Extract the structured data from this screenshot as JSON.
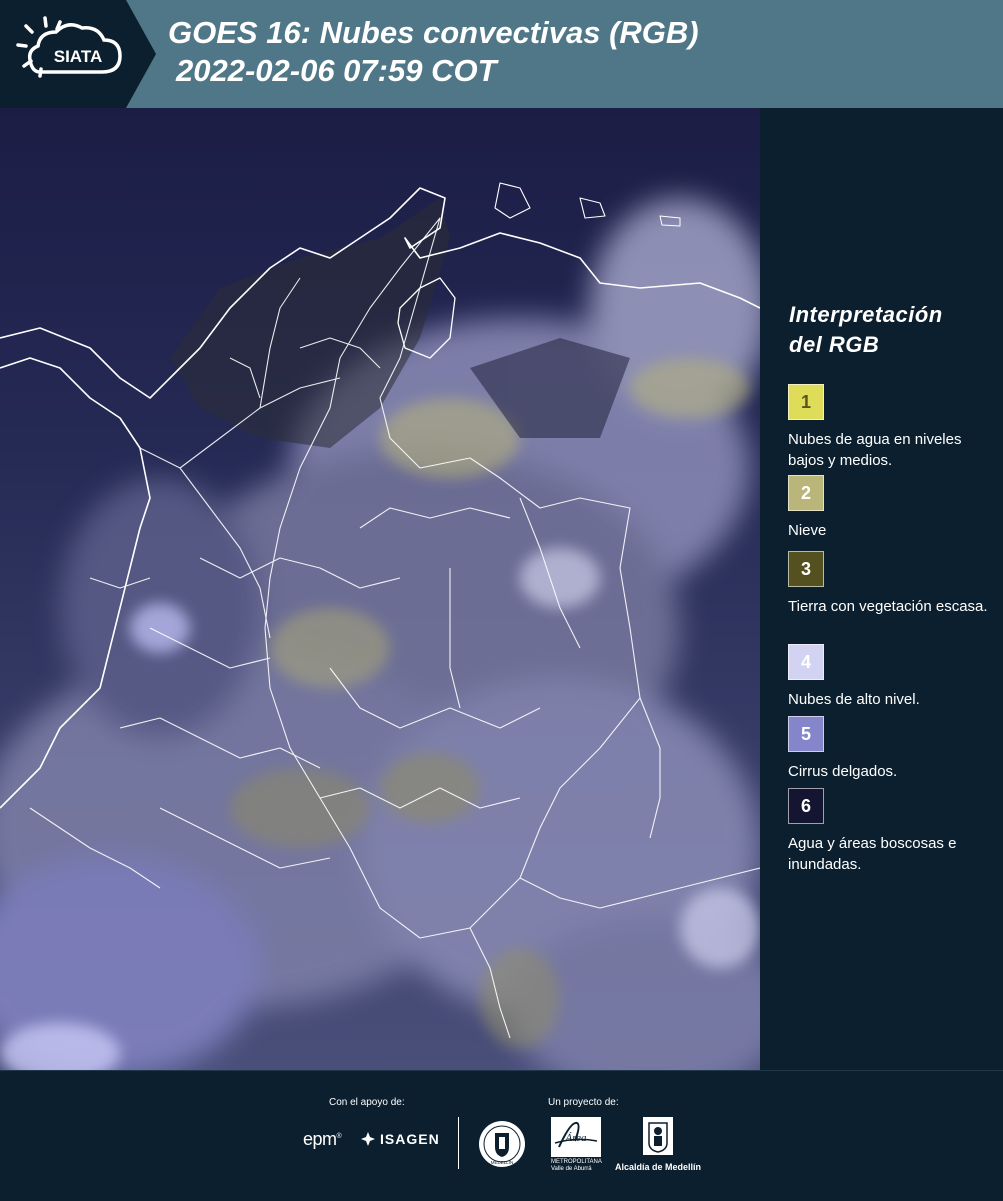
{
  "header": {
    "logo_text": "SIATA",
    "title_line1": "GOES 16: Nubes convectivas (RGB)",
    "title_line2": "2022-02-06 07:59 COT",
    "bg_color": "#4f7787"
  },
  "legend": {
    "title_line1": "Interpretación",
    "title_line2": "del RGB",
    "items": [
      {
        "number": "1",
        "label": "Nubes de agua en niveles bajos y medios.",
        "color": "#dfdc5a",
        "text_color": "#5a5520"
      },
      {
        "number": "2",
        "label": "Nieve",
        "color": "#bab679",
        "text_color": "#ffffff"
      },
      {
        "number": "3",
        "label": "Tierra con vegetación escasa.",
        "color": "#545020",
        "text_color": "#ffffff"
      },
      {
        "number": "4",
        "label": "Nubes de alto nivel.",
        "color": "#d2d2f3",
        "text_color": "#ffffff"
      },
      {
        "number": "5",
        "label": "Cirrus delgados.",
        "color": "#8585cc",
        "text_color": "#ffffff"
      },
      {
        "number": "6",
        "label": "Agua y áreas boscosas e inundadas.",
        "color": "#141530",
        "text_color": "#ffffff"
      }
    ]
  },
  "footer": {
    "support_label": "Con el apoyo de:",
    "project_label": "Un proyecto de:",
    "sponsor1": "epm",
    "sponsor2": "ISAGEN",
    "partner_area": "Área",
    "partner_area_sub": "METROPOLITANA Valle de Aburrá",
    "partner_alcaldia": "Alcaldía de Medellín",
    "seal_text": "MEDELLÍN"
  },
  "map": {
    "background_color": "#1a1d48",
    "border_color": "#ffffff"
  }
}
